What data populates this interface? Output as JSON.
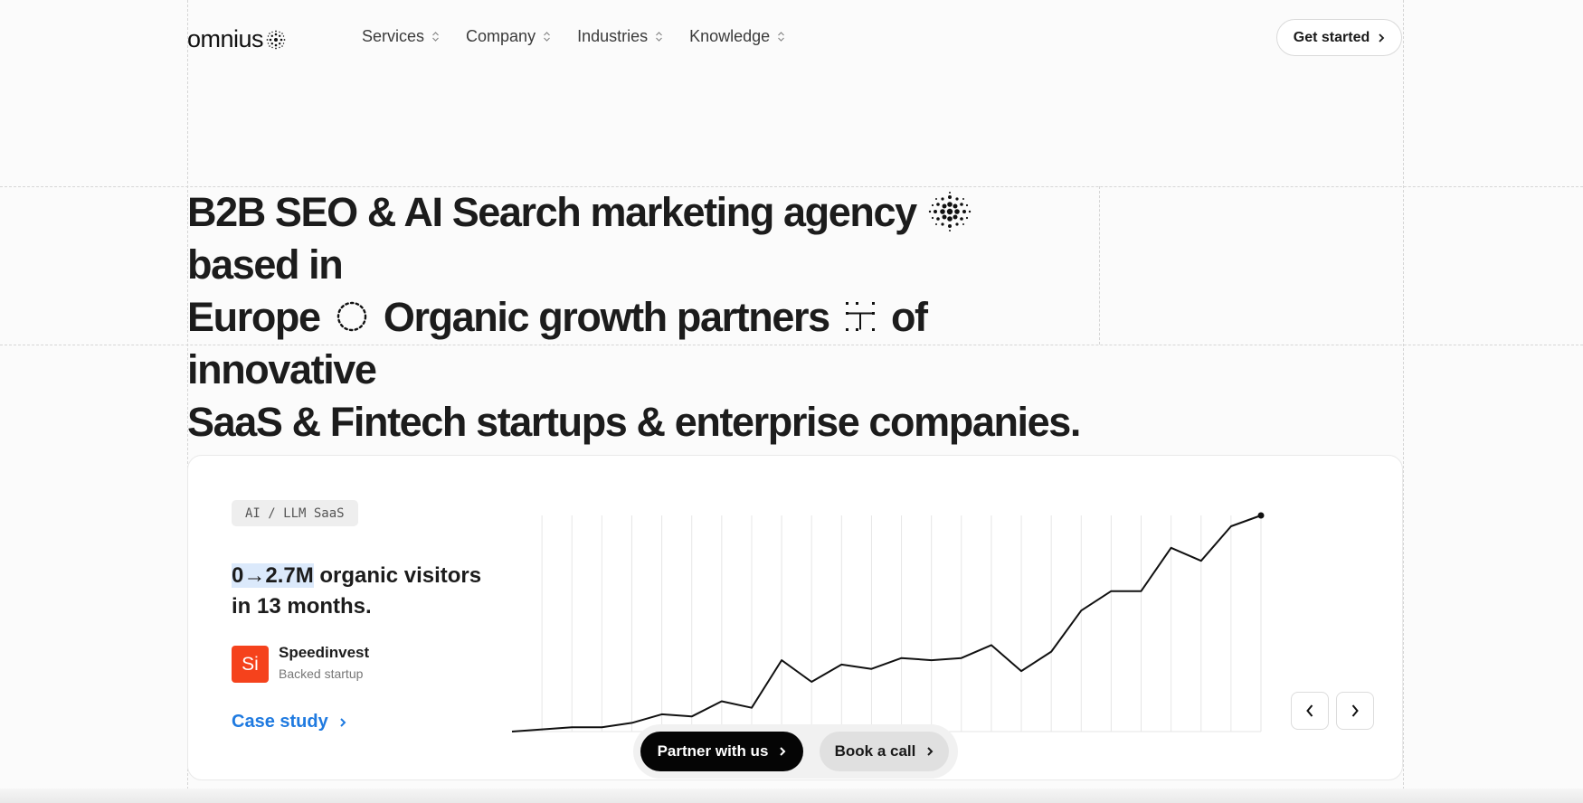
{
  "header": {
    "logo_text": "omnius",
    "nav": [
      {
        "label": "Services"
      },
      {
        "label": "Company"
      },
      {
        "label": "Industries"
      },
      {
        "label": "Knowledge"
      }
    ],
    "cta_label": "Get started"
  },
  "hero": {
    "line1_a": "B2B SEO & AI Search marketing agency",
    "line1_b": "based in",
    "line2_a": "Europe",
    "line2_b": "Organic growth partners",
    "line2_c": "of innovative",
    "line3": "SaaS & Fintech startups & enterprise companies."
  },
  "case_card": {
    "tag": "AI / LLM SaaS",
    "stat_highlight": "0→2.7M",
    "stat_rest": " organic visitors in 13 months.",
    "client_logo_text": "Si",
    "client_name": "Speedinvest",
    "client_sub": "Backed startup",
    "link_label": "Case study"
  },
  "chart_data": {
    "type": "line",
    "x": [
      0,
      1,
      2,
      3,
      4,
      5,
      6,
      7,
      8,
      9,
      10,
      11,
      12,
      13,
      14,
      15,
      16,
      17,
      18,
      19,
      20,
      21,
      22,
      23,
      24
    ],
    "values": [
      0.0,
      0.01,
      0.02,
      0.02,
      0.04,
      0.08,
      0.07,
      0.14,
      0.11,
      0.33,
      0.23,
      0.31,
      0.29,
      0.34,
      0.33,
      0.34,
      0.4,
      0.28,
      0.37,
      0.56,
      0.65,
      0.65,
      0.85,
      0.79,
      0.95,
      1.0
    ],
    "ylim": [
      0,
      1
    ],
    "grid": "vertical",
    "title": "",
    "xlabel": "",
    "ylabel": ""
  },
  "cta": {
    "partner_label": "Partner with us",
    "call_label": "Book a call"
  },
  "colors": {
    "accent": "#1f7ae0",
    "client_brand": "#f5421c",
    "highlight": "#dbe9fb"
  }
}
